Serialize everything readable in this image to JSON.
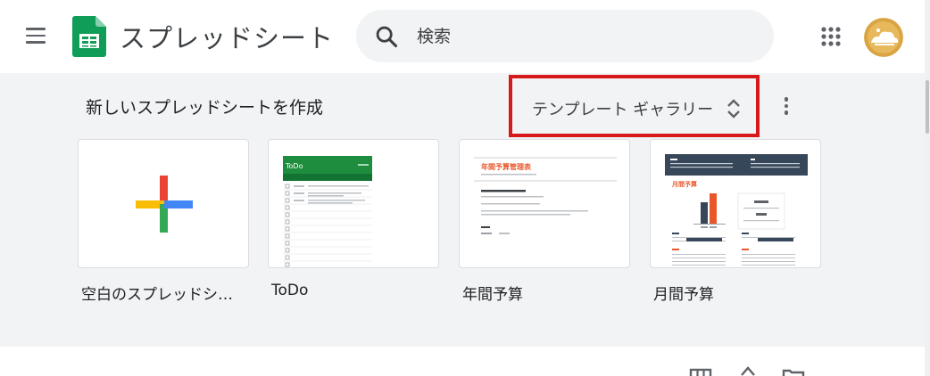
{
  "header": {
    "app_title": "スプレッドシート",
    "search_placeholder": "検索",
    "menu_icon": "hamburger-menu-icon",
    "apps_icon": "apps-grid-icon"
  },
  "templates": {
    "section_title": "新しいスプレッドシートを作成",
    "gallery_label": "テンプレート ギャラリー",
    "cards": [
      {
        "label": "空白のスプレッドシ…"
      },
      {
        "label": "ToDo",
        "thumb_title": "ToDo"
      },
      {
        "label": "年間予算",
        "thumb_title": "年間予算管理表"
      },
      {
        "label": "月間予算",
        "thumb_title": "月間予算"
      }
    ]
  },
  "colors": {
    "accent_highlight": "#d7191c",
    "sheets_green": "#0f9d58",
    "todo_green": "#1e8e3e",
    "budget_orange": "#e8562a",
    "budget_navy": "#37475a"
  }
}
